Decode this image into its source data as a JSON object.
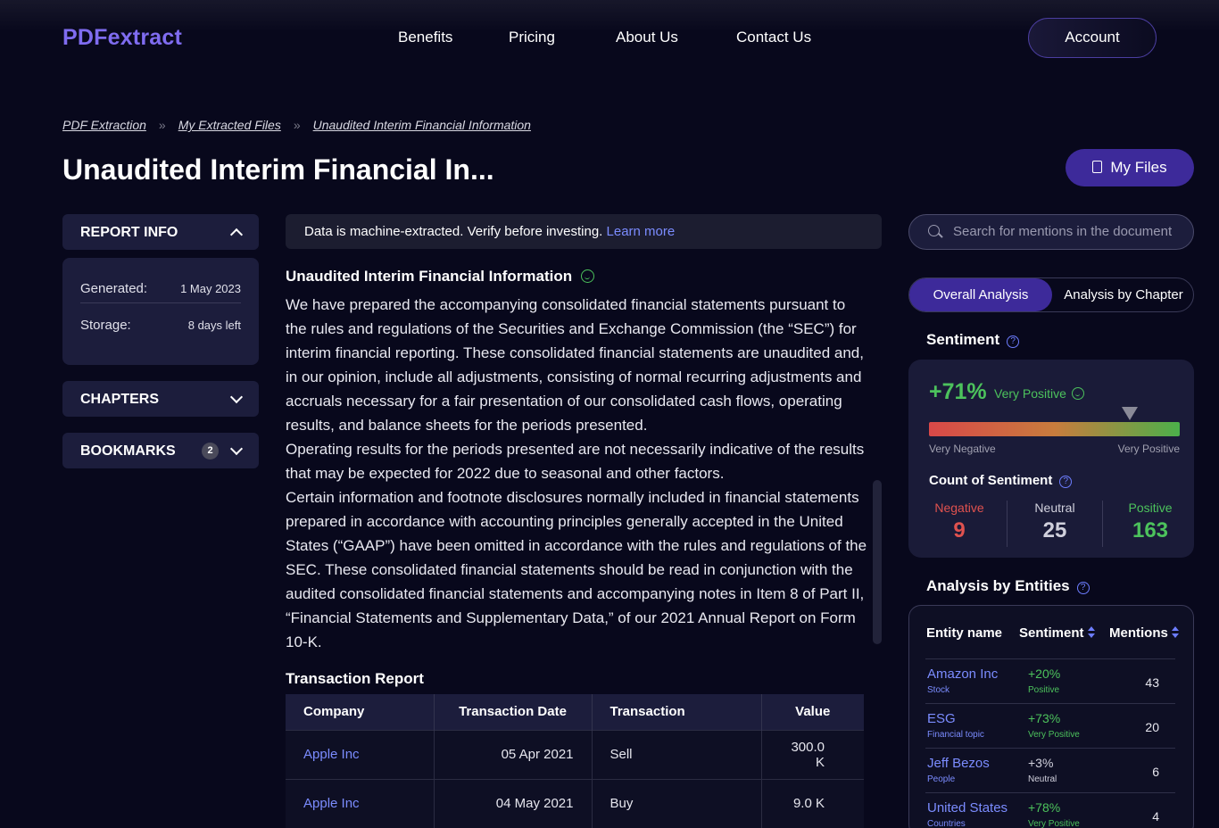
{
  "header": {
    "logo": "PDFextract",
    "nav": [
      "Benefits",
      "Pricing",
      "About Us",
      "Contact Us"
    ],
    "account": "Account"
  },
  "breadcrumb": [
    "PDF Extraction",
    "My Extracted Files",
    "Unaudited Interim Financial Information"
  ],
  "page": {
    "title": "Unaudited Interim Financial In...",
    "my_files": "My Files"
  },
  "sidebar": {
    "report_info": "REPORT INFO",
    "generated_label": "Generated:",
    "generated_value": "1 May 2023",
    "storage_label": "Storage:",
    "storage_value": "8 days left",
    "chapters": "CHAPTERS",
    "bookmarks": "BOOKMARKS",
    "bookmarks_count": "2"
  },
  "notice": {
    "text": "Data is machine-extracted. Verify before investing.",
    "link": "Learn more"
  },
  "content": {
    "section_title": "Unaudited Interim Financial Information",
    "paragraphs": [
      "We have prepared the accompanying consolidated financial statements pursuant to the rules and regulations of the Securities and Exchange Commission (the “SEC”) for interim financial reporting. These consolidated financial statements are unaudited and, in our opinion, include all adjustments, consisting of normal recurring adjustments and accruals necessary for a fair presentation of our consolidated cash flows, operating results, and balance sheets for the periods presented.",
      "Operating results for the periods presented are not necessarily indicative of the results that may be expected for 2022 due to seasonal and other factors.",
      "Certain information and footnote disclosures normally included in financial statements prepared in accordance with accounting principles generally accepted in the United States (“GAAP”) have been omitted in accordance with the rules and regulations of the SEC. These consolidated financial statements should be read in conjunction with the audited consolidated financial statements and accompanying notes in Item 8 of Part II, “Financial Statements and Supplementary Data,” of our 2021 Annual Report on Form 10-K."
    ]
  },
  "transactions": {
    "title": "Transaction Report",
    "columns": [
      "Company",
      "Transaction Date",
      "Transaction",
      "Value"
    ],
    "rows": [
      [
        "Apple Inc",
        "05 Apr 2021",
        "Sell",
        "300.0 K"
      ],
      [
        "Apple Inc",
        "04 May 2021",
        "Buy",
        "9.0 K"
      ]
    ]
  },
  "search": {
    "placeholder": "Search for mentions in the document"
  },
  "tabs": [
    "Overall Analysis",
    "Analysis by Chapter"
  ],
  "sentiment": {
    "title": "Sentiment",
    "percent": "+71%",
    "label": "Very Positive",
    "marker_level": 0.8,
    "scale_low": "Very Negative",
    "scale_high": "Very Positive",
    "count_title": "Count of Sentiment",
    "counts": [
      {
        "label": "Negative",
        "value": "9",
        "color": "#e0524f"
      },
      {
        "label": "Neutral",
        "value": "25",
        "color": "#d0d0dc"
      },
      {
        "label": "Positive",
        "value": "163",
        "color": "#4cc25c"
      }
    ]
  },
  "entities": {
    "title": "Analysis by Entities",
    "columns": [
      "Entity name",
      "Sentiment",
      "Mentions"
    ],
    "rows": [
      {
        "name": "Amazon Inc",
        "type": "Stock",
        "sentiment": "+20%",
        "sentiment_label": "Positive",
        "mentions": "43",
        "color": "#4cc25c"
      },
      {
        "name": "ESG",
        "type": "Financial topic",
        "sentiment": "+73%",
        "sentiment_label": "Very Positive",
        "mentions": "20",
        "color": "#4cc25c"
      },
      {
        "name": "Jeff Bezos",
        "type": "People",
        "sentiment": "+3%",
        "sentiment_label": "Neutral",
        "mentions": "6",
        "color": "#d0d0dc"
      },
      {
        "name": "United States",
        "type": "Countries",
        "sentiment": "+78%",
        "sentiment_label": "Very Positive",
        "mentions": "4",
        "color": "#4cc25c"
      }
    ]
  },
  "colors": {
    "accent": "#3d2a9a",
    "link": "#7b8cff",
    "positive": "#4cc25c",
    "negative": "#e0524f",
    "background": "#08081c"
  }
}
